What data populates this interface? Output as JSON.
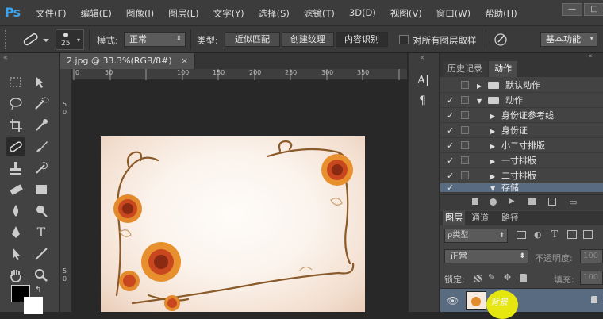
{
  "app": {
    "logo": "Ps"
  },
  "menu": [
    "文件(F)",
    "编辑(E)",
    "图像(I)",
    "图层(L)",
    "文字(Y)",
    "选择(S)",
    "滤镜(T)",
    "3D(D)",
    "视图(V)",
    "窗口(W)",
    "帮助(H)"
  ],
  "window_controls": {
    "minimize": "—",
    "maximize": "□"
  },
  "options": {
    "brush_size": "25",
    "mode_label": "模式:",
    "mode_value": "正常",
    "type_label": "类型:",
    "type_options": [
      "近似匹配",
      "创建纹理",
      "内容识别"
    ],
    "type_selected": "内容识别",
    "sample_all_label": "对所有图层取样",
    "workspace": "基本功能"
  },
  "document": {
    "tab_title": "2.jpg @ 33.3%(RGB/8#)",
    "close": "×",
    "ruler_top": [
      "0",
      "50",
      "100",
      "150",
      "200",
      "250",
      "300",
      "350"
    ],
    "ruler_left": [
      "5",
      "0",
      "5",
      "0"
    ]
  },
  "right_panel": {
    "collapse": "«",
    "tabs": [
      "历史记录",
      "动作"
    ],
    "active_tab": "动作",
    "actions": [
      {
        "label": "默认动作",
        "checked": false,
        "folder": true,
        "level": 0
      },
      {
        "label": "动作",
        "checked": true,
        "folder": true,
        "level": 0
      },
      {
        "label": "身份证参考线",
        "checked": true,
        "folder": false,
        "level": 1
      },
      {
        "label": "身份证",
        "checked": true,
        "folder": false,
        "level": 1
      },
      {
        "label": "小二寸排版",
        "checked": true,
        "folder": false,
        "level": 1
      },
      {
        "label": "一寸排版",
        "checked": true,
        "folder": false,
        "level": 1
      },
      {
        "label": "二寸排版",
        "checked": true,
        "folder": false,
        "level": 1
      },
      {
        "label": "存储",
        "checked": true,
        "folder": false,
        "level": 1
      }
    ],
    "layers_tabs": [
      "图层",
      "通道",
      "路径"
    ],
    "layers_active": "图层",
    "kind_label": "ρ类型",
    "blend_mode": "正常",
    "opacity_label": "不透明度:",
    "opacity_value": "100",
    "lock_label": "锁定:",
    "fill_label": "填充:",
    "fill_value": "100",
    "layer_name": "背景"
  },
  "colors": {
    "accent": "#3aa4f0",
    "foreground": "#000000",
    "background": "#ffffff"
  }
}
